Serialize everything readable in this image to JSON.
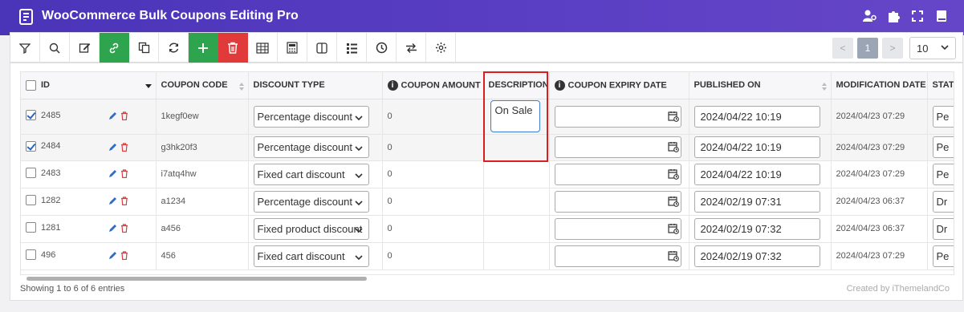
{
  "header": {
    "title": "WooCommerce Bulk Coupons Editing Pro"
  },
  "toolbar": {
    "pages": [
      "<",
      "1",
      ">"
    ],
    "per_page": "10"
  },
  "columns": [
    "ID",
    "COUPON CODE",
    "DISCOUNT TYPE",
    "COUPON AMOUNT",
    "DESCRIPTION",
    "COUPON EXPIRY DATE",
    "PUBLISHED ON",
    "MODIFICATION DATE",
    "STAT"
  ],
  "rows": [
    {
      "checked": true,
      "id": "2485",
      "code": "1kegf0ew",
      "type": "Percentage discount",
      "amount": "0",
      "description": "On Sale",
      "published": "2024/04/22 10:19",
      "modified": "2024/04/23 07:29",
      "status": "Pe"
    },
    {
      "checked": true,
      "id": "2484",
      "code": "g3hk20f3",
      "type": "Percentage discount",
      "amount": "0",
      "description": "",
      "published": "2024/04/22 10:19",
      "modified": "2024/04/23 07:29",
      "status": "Pe"
    },
    {
      "checked": false,
      "id": "2483",
      "code": "i7atq4hw",
      "type": "Fixed cart discount",
      "amount": "0",
      "description": "",
      "published": "2024/04/22 10:19",
      "modified": "2024/04/23 07:29",
      "status": "Pe"
    },
    {
      "checked": false,
      "id": "1282",
      "code": "a1234",
      "type": "Percentage discount",
      "amount": "0",
      "description": "",
      "published": "2024/02/19 07:31",
      "modified": "2024/04/23 06:37",
      "status": "Dr"
    },
    {
      "checked": false,
      "id": "1281",
      "code": "a456",
      "type": "Fixed product discount",
      "amount": "0",
      "description": "",
      "published": "2024/02/19 07:32",
      "modified": "2024/04/23 06:37",
      "status": "Dr"
    },
    {
      "checked": false,
      "id": "496",
      "code": "456",
      "type": "Fixed cart discount",
      "amount": "0",
      "description": "",
      "published": "2024/02/19 07:32",
      "modified": "2024/04/23 07:29",
      "status": "Pe"
    }
  ],
  "footer": {
    "entries": "Showing 1 to 6 of 6 entries",
    "credit": "Created by iThemelandCo"
  },
  "colors": {
    "header": "#5b3fc4",
    "green": "#2ea44f",
    "red": "#e03a3a",
    "highlight": "#d81e1e"
  }
}
